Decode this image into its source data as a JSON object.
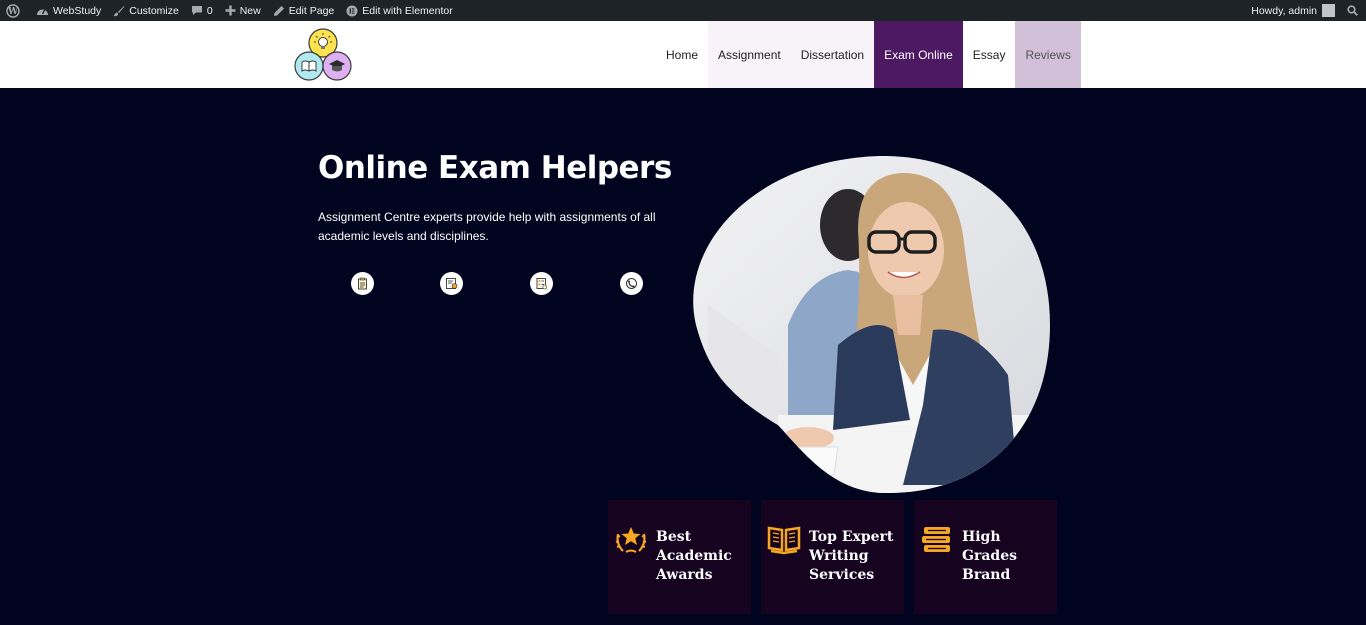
{
  "admin_bar": {
    "site_name": "WebStudy",
    "customize": "Customize",
    "comments_count": "0",
    "new": "New",
    "edit_page": "Edit Page",
    "edit_elementor": "Edit with Elementor",
    "howdy": "Howdy, admin"
  },
  "nav": {
    "items": [
      "Home",
      "Assignment",
      "Dissertation",
      "Exam Online",
      "Essay",
      "Reviews"
    ],
    "active": "Exam Online"
  },
  "hero": {
    "title": "Online Exam Helpers",
    "text": "Assignment Centre experts provide help with assignments of all academic levels and disciplines."
  },
  "feature_icons": [
    "clipboard-icon",
    "document-badge-icon",
    "checklist-icon",
    "support-icon"
  ],
  "cards": [
    {
      "label": "Best Academic Awards",
      "icon": "award-star-icon"
    },
    {
      "label": "Top Expert Writing Services",
      "icon": "open-book-icon"
    },
    {
      "label": "High Grades Brand",
      "icon": "books-stack-icon"
    }
  ],
  "colors": {
    "admin_bar": "#1d2327",
    "hero_bg": "#01041e",
    "nav_active": "#4c1962",
    "card_bg": "#160320",
    "accent_gold": "#f5a623"
  }
}
